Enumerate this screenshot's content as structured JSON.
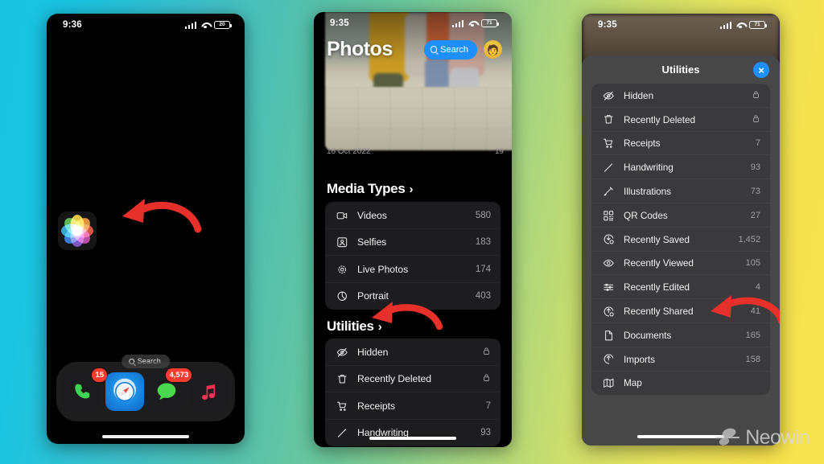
{
  "background": {
    "from": "#18c3e2",
    "mid": "#6ec79a",
    "to": "#f7e44f"
  },
  "watermark": {
    "text": "Neowin",
    "logo_icon": "neowin-logo-icon"
  },
  "phone1": {
    "status": {
      "time": "9:36",
      "battery": "20",
      "signal_icon": "cellular-bars-icon",
      "wifi_icon": "wifi-icon",
      "battery_icon": "battery-icon"
    },
    "app_icon": {
      "name": "Photos",
      "icon": "photos-app-icon"
    },
    "search": {
      "label": "Search",
      "icon": "search-icon"
    },
    "dock": [
      {
        "name": "Phone",
        "icon": "phone-app-icon",
        "badge": "15"
      },
      {
        "name": "Safari",
        "icon": "safari-app-icon",
        "badge": ""
      },
      {
        "name": "Messages",
        "icon": "messages-app-icon",
        "badge": "4,573"
      },
      {
        "name": "Music",
        "icon": "music-app-icon",
        "badge": ""
      }
    ],
    "annotation": {
      "arrow_color": "#e8302a",
      "points_to": "photos-app-icon"
    }
  },
  "phone2": {
    "status": {
      "time": "9:35",
      "battery": "71"
    },
    "header": {
      "title": "Photos",
      "search_label": "Search",
      "search_icon": "search-icon",
      "avatar_icon": "user-avatar-icon"
    },
    "hero": {
      "date_left": "16 Oct 2022",
      "date_right": "19"
    },
    "sections": [
      {
        "title": "Media Types",
        "chevron": "›",
        "rows": [
          {
            "icon": "video-camera-icon",
            "label": "Videos",
            "value": "580"
          },
          {
            "icon": "selfie-portrait-icon",
            "label": "Selfies",
            "value": "183"
          },
          {
            "icon": "live-photo-icon",
            "label": "Live Photos",
            "value": "174"
          },
          {
            "icon": "portrait-aperture-icon",
            "label": "Portrait",
            "value": "403"
          }
        ]
      },
      {
        "title": "Utilities",
        "chevron": "›",
        "rows": [
          {
            "icon": "eye-slash-icon",
            "label": "Hidden",
            "value": "",
            "locked": true
          },
          {
            "icon": "trash-icon",
            "label": "Recently Deleted",
            "value": "",
            "locked": true
          },
          {
            "icon": "cart-icon",
            "label": "Receipts",
            "value": "7"
          },
          {
            "icon": "pencil-icon",
            "label": "Handwriting",
            "value": "93"
          }
        ]
      }
    ],
    "annotation": {
      "arrow_color": "#e8302a",
      "points_to": "utilities-section-header"
    }
  },
  "phone3": {
    "status": {
      "time": "9:35",
      "battery": "71"
    },
    "sheet": {
      "title": "Utilities",
      "close_label": "×",
      "close_icon": "close-circle-icon"
    },
    "rows": [
      {
        "icon": "eye-slash-icon",
        "label": "Hidden",
        "value": "",
        "locked": true
      },
      {
        "icon": "trash-icon",
        "label": "Recently Deleted",
        "value": "",
        "locked": true
      },
      {
        "icon": "cart-icon",
        "label": "Receipts",
        "value": "7"
      },
      {
        "icon": "pencil-icon",
        "label": "Handwriting",
        "value": "93"
      },
      {
        "icon": "scribble-icon",
        "label": "Illustrations",
        "value": "73"
      },
      {
        "icon": "qr-code-icon",
        "label": "QR Codes",
        "value": "27"
      },
      {
        "icon": "download-clock-icon",
        "label": "Recently Saved",
        "value": "1,452"
      },
      {
        "icon": "eye-icon",
        "label": "Recently Viewed",
        "value": "105"
      },
      {
        "icon": "sliders-icon",
        "label": "Recently Edited",
        "value": "4"
      },
      {
        "icon": "share-clock-icon",
        "label": "Recently Shared",
        "value": "41"
      },
      {
        "icon": "document-icon",
        "label": "Documents",
        "value": "165"
      },
      {
        "icon": "import-icon",
        "label": "Imports",
        "value": "158"
      },
      {
        "icon": "map-icon",
        "label": "Map",
        "value": ""
      }
    ],
    "annotation": {
      "arrow_color": "#e8302a",
      "points_to": "row-recently-shared"
    }
  }
}
